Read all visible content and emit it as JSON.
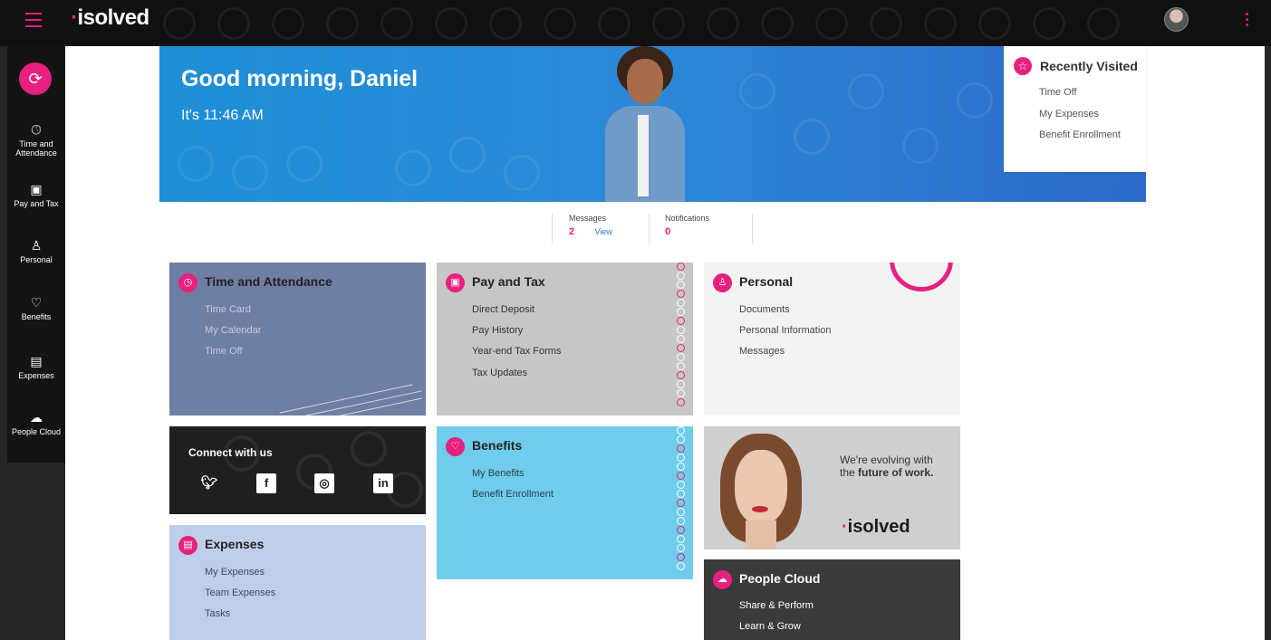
{
  "app": {
    "logo": "isolved",
    "logo_dot": "·"
  },
  "topbar": {
    "menu_icon": "hamburger-icon",
    "more_icon": "kebab-icon"
  },
  "sidebar": {
    "badge_icon": "refresh-icon",
    "items": [
      {
        "label_line1": "Time and",
        "label_line2": "Attendance",
        "icon": "clock-icon"
      },
      {
        "label": "Pay and Tax",
        "icon": "money-icon"
      },
      {
        "label": "Personal",
        "icon": "person-icon"
      },
      {
        "label": "Benefits",
        "icon": "heart-icon"
      },
      {
        "label": "Expenses",
        "icon": "receipt-icon"
      },
      {
        "label": "People Cloud",
        "icon": "cloud-icon"
      }
    ]
  },
  "hero": {
    "greeting": "Good morning, Daniel",
    "time": "It's 11:46 AM"
  },
  "recently_visited": {
    "title": "Recently Visited",
    "links": [
      "Time Off",
      "My Expenses",
      "Benefit Enrollment"
    ]
  },
  "stats": {
    "messages_label": "Messages",
    "messages_count": "2",
    "view_label": "View",
    "notifications_label": "Notifications",
    "notifications_count": "0"
  },
  "cards": {
    "time_attendance": {
      "title": "Time and Attendance",
      "links": [
        "Time Card",
        "My Calendar",
        "Time Off"
      ]
    },
    "pay_tax": {
      "title": "Pay and Tax",
      "links": [
        "Direct Deposit",
        "Pay History",
        "Year-end Tax Forms",
        "Tax Updates"
      ]
    },
    "personal": {
      "title": "Personal",
      "links": [
        "Documents",
        "Personal Information",
        "Messages"
      ]
    },
    "benefits": {
      "title": "Benefits",
      "links": [
        "My Benefits",
        "Benefit Enrollment"
      ]
    },
    "expenses": {
      "title": "Expenses",
      "links": [
        "My Expenses",
        "Team Expenses",
        "Tasks"
      ]
    },
    "people_cloud": {
      "title": "People Cloud",
      "links": [
        "Share & Perform",
        "Learn & Grow"
      ]
    }
  },
  "connect": {
    "title": "Connect with us",
    "social": [
      "twitter-icon",
      "facebook-icon",
      "instagram-icon",
      "linkedin-icon"
    ]
  },
  "promo": {
    "line1": "We're evolving with",
    "line2_prefix": "the ",
    "line2_bold": "future of work.",
    "logo": "isolved"
  },
  "colors": {
    "accent": "#e8207e",
    "hero": "#1e8fd6",
    "dark": "#111111"
  }
}
